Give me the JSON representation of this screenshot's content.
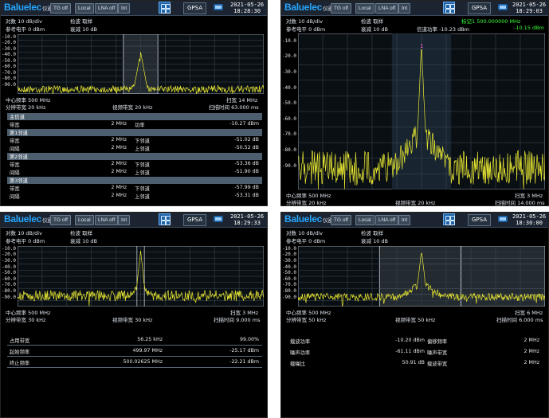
{
  "common": {
    "logo_brand": "Baluelec",
    "logo_suffix": "仪器",
    "tg_label": "TG off",
    "local_label": "Local",
    "lna_label": "LNA off",
    "int_label": "Int",
    "mode_label": "GPSA",
    "trace_color": "#e8e832",
    "accent": "#27a6ff",
    "marker_text_color": "#3cff3c",
    "y_ticks": [
      "-10.0",
      "-20.0",
      "-30.0",
      "-40.0",
      "-50.0",
      "-60.0",
      "-70.0",
      "-80.0",
      "-90.0"
    ],
    "y_ticks_p2": [
      "-10.0",
      "-20.0",
      "-30.0",
      "-40.0",
      "-50.0",
      "-60.0",
      "-70.0",
      "-80.0",
      "-90.0"
    ]
  },
  "panels": [
    {
      "date": "2021-05-26",
      "time": "18:28:30",
      "scale": "对数 10 dB/div",
      "detect": "检波 取样",
      "ref": "参考电平 0 dBm",
      "atten": "衰减 10 dB",
      "center": "中心频率 500 MHz",
      "span": "扫宽 14 MHz",
      "rbw": "分辨带宽 20 kHz",
      "vbw": "视频带宽 20 kHz",
      "sweep": "扫描时间 63.000 ms",
      "table": [
        {
          "type": "sec",
          "label": "主信道"
        },
        {
          "type": "row",
          "a": "带宽",
          "b": "2 MHz",
          "c": "功率",
          "d": "-10.27 dBm"
        },
        {
          "type": "sec",
          "label": "第1邻道"
        },
        {
          "type": "row",
          "a": "带宽",
          "b": "2 MHz",
          "c": "下邻道",
          "d": "-51.02 dB"
        },
        {
          "type": "row",
          "a": "间隔",
          "b": "2 MHz",
          "c": "上邻道",
          "d": "-50.52 dB"
        },
        {
          "type": "sec",
          "label": "第2邻道"
        },
        {
          "type": "row",
          "a": "带宽",
          "b": "2 MHz",
          "c": "下邻道",
          "d": "-53.36 dB"
        },
        {
          "type": "row",
          "a": "间隔",
          "b": "2 MHz",
          "c": "上邻道",
          "d": "-51.90 dB"
        },
        {
          "type": "sec",
          "label": "第3邻道"
        },
        {
          "type": "row",
          "a": "带宽",
          "b": "2 MHz",
          "c": "下邻道",
          "d": "-57.99 dB"
        },
        {
          "type": "row",
          "a": "间隔",
          "b": "2 MHz",
          "c": "上邻道",
          "d": "-53.31 dB"
        }
      ]
    },
    {
      "date": "2021-05-26",
      "time": "18:29:03",
      "scale": "对数 10 dB/div",
      "detect": "检波 取样",
      "ref": "参考电平 0 dBm",
      "atten": "衰减 10 dB",
      "channel_power": "信道功率 -10.23 dBm",
      "marker": "标记1  500.000000 MHz",
      "marker_level": "-10.15 dBm",
      "center": "中心频率 500 MHz",
      "span": "扫宽 3 MHz",
      "rbw": "分辨带宽 20 kHz",
      "vbw": "视频带宽 20 kHz",
      "sweep": "扫描时间 14.000 ms",
      "marker_num": "1"
    },
    {
      "date": "2021-05-26",
      "time": "18:29:33",
      "scale": "对数 10 dB/div",
      "detect": "检波 取样",
      "ref": "参考电平 0 dBm",
      "atten": "衰减 10 dB",
      "center": "中心频率 500 MHz",
      "span": "扫宽 3 MHz",
      "rbw": "分辨带宽 30 kHz",
      "vbw": "视频带宽 30 kHz",
      "sweep": "扫描时间 9.000 ms",
      "table": [
        {
          "a": "占用带宽",
          "b": "56.25 kHz",
          "c": "",
          "d": "99.00%"
        },
        {
          "a": "起始频率",
          "b": "499.97 MHz",
          "c": "",
          "d": "-25.17 dBm"
        },
        {
          "a": "终止频率",
          "b": "500.02625 MHz",
          "c": "",
          "d": "-22.21 dBm"
        }
      ]
    },
    {
      "date": "2021-05-26",
      "time": "18:30:00",
      "scale": "对数 10 dB/div",
      "detect": "检波 取样",
      "ref": "参考电平 0 dBm",
      "atten": "衰减 10 dB",
      "center": "中心频率 500 MHz",
      "span": "扫宽 6 MHz",
      "rbw": "分辨带宽 50 kHz",
      "vbw": "视频带宽 50 kHz",
      "sweep": "扫描时间 6.000 ms",
      "table": [
        {
          "a": "载波功率",
          "b": "-10.20 dBm",
          "c": "偏移频率",
          "d": "2 MHz"
        },
        {
          "a": "噪声功率",
          "b": "-61.11 dBm",
          "c": "噪声带宽",
          "d": "2 MHz"
        },
        {
          "a": "载噪比",
          "b": "50.91 dB",
          "c": "载波带宽",
          "d": "2 MHz"
        }
      ]
    }
  ]
}
